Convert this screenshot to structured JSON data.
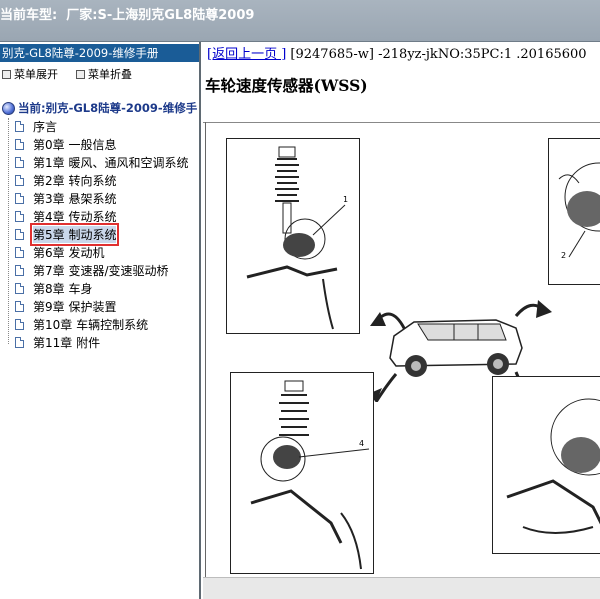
{
  "window": {
    "title_label": "当前车型:",
    "title_value": "厂家:S-上海别克GL8陆尊2009"
  },
  "sidebar": {
    "header": "别克-GL8陆尊-2009-维修手册",
    "expand_label": "菜单展开",
    "collapse_label": "菜单折叠",
    "root_label": "当前:别克-GL8陆尊-2009-维修手",
    "items": [
      {
        "label": "序言"
      },
      {
        "label": "第0章 一般信息"
      },
      {
        "label": "第1章 暖风、通风和空调系统"
      },
      {
        "label": "第2章 转向系统"
      },
      {
        "label": "第3章 悬架系统"
      },
      {
        "label": "第4章 传动系统"
      },
      {
        "label": "第5章 制动系统",
        "selected": true
      },
      {
        "label": "第6章 发动机"
      },
      {
        "label": "第7章 变速器/变速驱动桥"
      },
      {
        "label": "第8章 车身"
      },
      {
        "label": "第9章 保护装置"
      },
      {
        "label": "第10章 车辆控制系统"
      },
      {
        "label": "第11章 附件"
      }
    ]
  },
  "content": {
    "back_link": "[返回上一页 ]",
    "doc_ref": "[9247685-w] -218yz-jkNO:35PC:1 .20165600",
    "page_title": "车轮速度传感器(WSS)",
    "callouts": [
      "1",
      "2",
      "4"
    ]
  },
  "colors": {
    "titlebar": "#9aa6b2",
    "sidebar_header": "#1a5c97",
    "selection_outline": "#e03030",
    "link": "#0000cc"
  }
}
